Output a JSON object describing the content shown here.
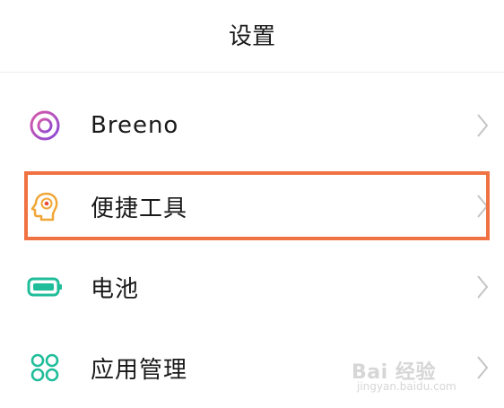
{
  "header": {
    "title": "设置"
  },
  "settings": {
    "items": [
      {
        "label": "Breeno",
        "icon": "breeno-icon",
        "color": "#b04fc4"
      },
      {
        "label": "便捷工具",
        "icon": "convenience-tools-icon",
        "color": "#f0a637"
      },
      {
        "label": "电池",
        "icon": "battery-icon",
        "color": "#1fbd9a"
      },
      {
        "label": "应用管理",
        "icon": "app-management-icon",
        "color": "#1fbd9a"
      }
    ]
  },
  "highlight": {
    "color": "#f07242",
    "target": "便捷工具"
  },
  "watermark": {
    "brand": "Bai 经验",
    "url": "jingyan.baidu.com"
  }
}
